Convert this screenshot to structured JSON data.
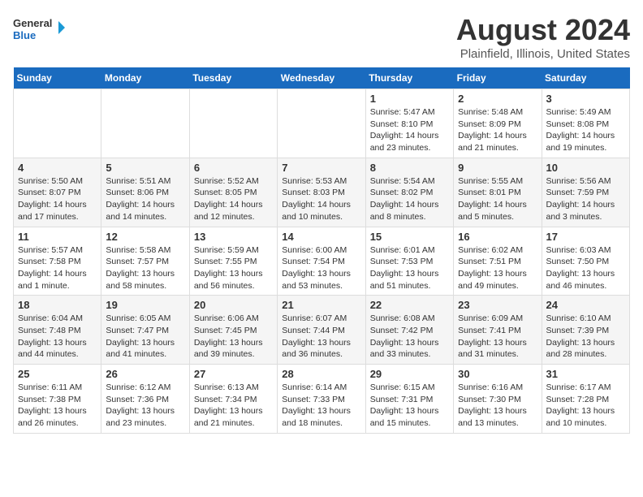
{
  "logo": {
    "line1": "General",
    "line2": "Blue"
  },
  "title": "August 2024",
  "location": "Plainfield, Illinois, United States",
  "days_of_week": [
    "Sunday",
    "Monday",
    "Tuesday",
    "Wednesday",
    "Thursday",
    "Friday",
    "Saturday"
  ],
  "weeks": [
    [
      {
        "day": "",
        "info": ""
      },
      {
        "day": "",
        "info": ""
      },
      {
        "day": "",
        "info": ""
      },
      {
        "day": "",
        "info": ""
      },
      {
        "day": "1",
        "info": "Sunrise: 5:47 AM\nSunset: 8:10 PM\nDaylight: 14 hours\nand 23 minutes."
      },
      {
        "day": "2",
        "info": "Sunrise: 5:48 AM\nSunset: 8:09 PM\nDaylight: 14 hours\nand 21 minutes."
      },
      {
        "day": "3",
        "info": "Sunrise: 5:49 AM\nSunset: 8:08 PM\nDaylight: 14 hours\nand 19 minutes."
      }
    ],
    [
      {
        "day": "4",
        "info": "Sunrise: 5:50 AM\nSunset: 8:07 PM\nDaylight: 14 hours\nand 17 minutes."
      },
      {
        "day": "5",
        "info": "Sunrise: 5:51 AM\nSunset: 8:06 PM\nDaylight: 14 hours\nand 14 minutes."
      },
      {
        "day": "6",
        "info": "Sunrise: 5:52 AM\nSunset: 8:05 PM\nDaylight: 14 hours\nand 12 minutes."
      },
      {
        "day": "7",
        "info": "Sunrise: 5:53 AM\nSunset: 8:03 PM\nDaylight: 14 hours\nand 10 minutes."
      },
      {
        "day": "8",
        "info": "Sunrise: 5:54 AM\nSunset: 8:02 PM\nDaylight: 14 hours\nand 8 minutes."
      },
      {
        "day": "9",
        "info": "Sunrise: 5:55 AM\nSunset: 8:01 PM\nDaylight: 14 hours\nand 5 minutes."
      },
      {
        "day": "10",
        "info": "Sunrise: 5:56 AM\nSunset: 7:59 PM\nDaylight: 14 hours\nand 3 minutes."
      }
    ],
    [
      {
        "day": "11",
        "info": "Sunrise: 5:57 AM\nSunset: 7:58 PM\nDaylight: 14 hours\nand 1 minute."
      },
      {
        "day": "12",
        "info": "Sunrise: 5:58 AM\nSunset: 7:57 PM\nDaylight: 13 hours\nand 58 minutes."
      },
      {
        "day": "13",
        "info": "Sunrise: 5:59 AM\nSunset: 7:55 PM\nDaylight: 13 hours\nand 56 minutes."
      },
      {
        "day": "14",
        "info": "Sunrise: 6:00 AM\nSunset: 7:54 PM\nDaylight: 13 hours\nand 53 minutes."
      },
      {
        "day": "15",
        "info": "Sunrise: 6:01 AM\nSunset: 7:53 PM\nDaylight: 13 hours\nand 51 minutes."
      },
      {
        "day": "16",
        "info": "Sunrise: 6:02 AM\nSunset: 7:51 PM\nDaylight: 13 hours\nand 49 minutes."
      },
      {
        "day": "17",
        "info": "Sunrise: 6:03 AM\nSunset: 7:50 PM\nDaylight: 13 hours\nand 46 minutes."
      }
    ],
    [
      {
        "day": "18",
        "info": "Sunrise: 6:04 AM\nSunset: 7:48 PM\nDaylight: 13 hours\nand 44 minutes."
      },
      {
        "day": "19",
        "info": "Sunrise: 6:05 AM\nSunset: 7:47 PM\nDaylight: 13 hours\nand 41 minutes."
      },
      {
        "day": "20",
        "info": "Sunrise: 6:06 AM\nSunset: 7:45 PM\nDaylight: 13 hours\nand 39 minutes."
      },
      {
        "day": "21",
        "info": "Sunrise: 6:07 AM\nSunset: 7:44 PM\nDaylight: 13 hours\nand 36 minutes."
      },
      {
        "day": "22",
        "info": "Sunrise: 6:08 AM\nSunset: 7:42 PM\nDaylight: 13 hours\nand 33 minutes."
      },
      {
        "day": "23",
        "info": "Sunrise: 6:09 AM\nSunset: 7:41 PM\nDaylight: 13 hours\nand 31 minutes."
      },
      {
        "day": "24",
        "info": "Sunrise: 6:10 AM\nSunset: 7:39 PM\nDaylight: 13 hours\nand 28 minutes."
      }
    ],
    [
      {
        "day": "25",
        "info": "Sunrise: 6:11 AM\nSunset: 7:38 PM\nDaylight: 13 hours\nand 26 minutes."
      },
      {
        "day": "26",
        "info": "Sunrise: 6:12 AM\nSunset: 7:36 PM\nDaylight: 13 hours\nand 23 minutes."
      },
      {
        "day": "27",
        "info": "Sunrise: 6:13 AM\nSunset: 7:34 PM\nDaylight: 13 hours\nand 21 minutes."
      },
      {
        "day": "28",
        "info": "Sunrise: 6:14 AM\nSunset: 7:33 PM\nDaylight: 13 hours\nand 18 minutes."
      },
      {
        "day": "29",
        "info": "Sunrise: 6:15 AM\nSunset: 7:31 PM\nDaylight: 13 hours\nand 15 minutes."
      },
      {
        "day": "30",
        "info": "Sunrise: 6:16 AM\nSunset: 7:30 PM\nDaylight: 13 hours\nand 13 minutes."
      },
      {
        "day": "31",
        "info": "Sunrise: 6:17 AM\nSunset: 7:28 PM\nDaylight: 13 hours\nand 10 minutes."
      }
    ]
  ]
}
